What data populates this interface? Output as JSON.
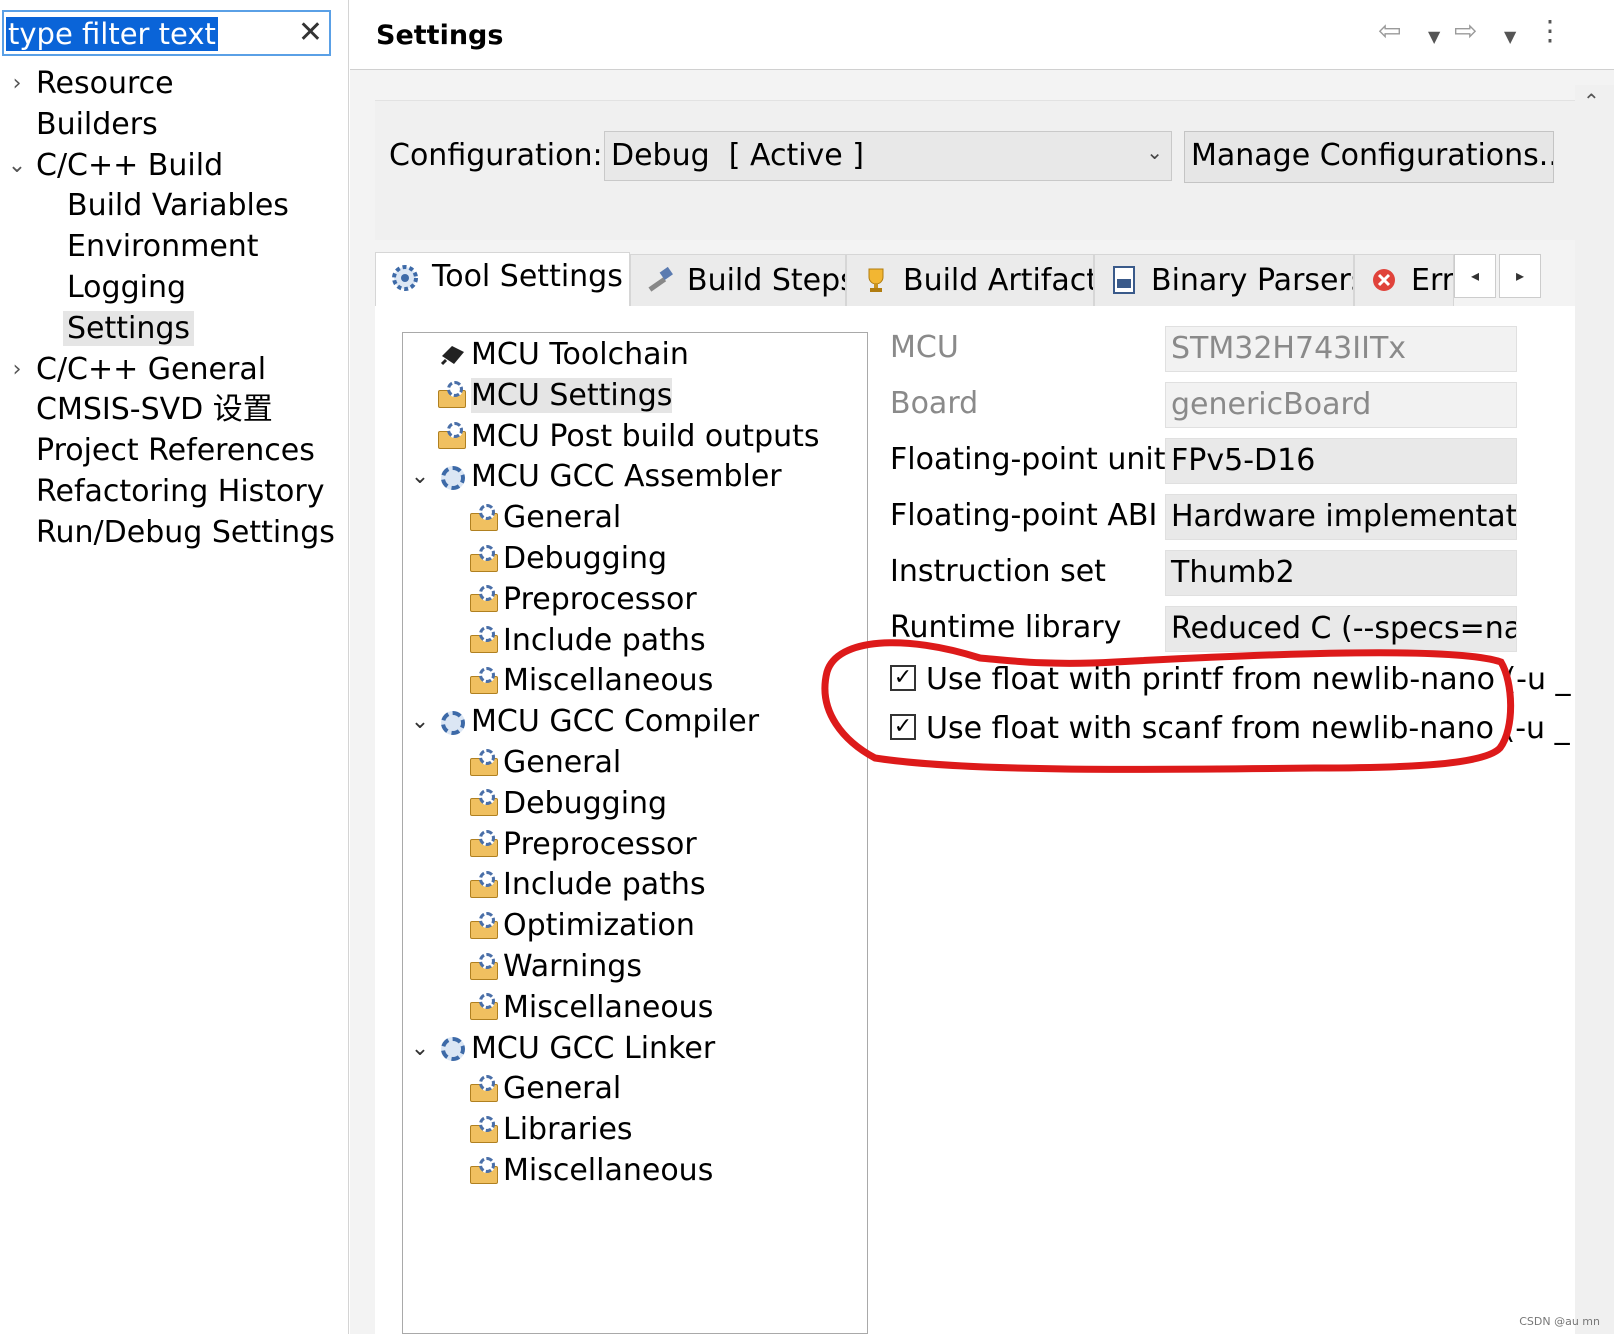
{
  "filter": {
    "value": "type filter text",
    "clear_glyph": "✕"
  },
  "nav": [
    {
      "label": "Resource",
      "twisty": "›"
    },
    {
      "label": "Builders",
      "twisty": ""
    },
    {
      "label": "C/C++ Build",
      "twisty": "⌄"
    },
    {
      "label": "Build Variables",
      "twisty": ""
    },
    {
      "label": "Environment",
      "twisty": ""
    },
    {
      "label": "Logging",
      "twisty": ""
    },
    {
      "label": "Settings",
      "twisty": "",
      "selected": true
    },
    {
      "label": "C/C++ General",
      "twisty": "›"
    },
    {
      "label": "CMSIS-SVD 设置",
      "twisty": ""
    },
    {
      "label": "Project References",
      "twisty": ""
    },
    {
      "label": "Refactoring History",
      "twisty": ""
    },
    {
      "label": "Run/Debug Settings",
      "twisty": ""
    }
  ],
  "header": {
    "title": "Settings",
    "back_icon": "⇦",
    "back_menu_icon": "▼",
    "forward_icon": "⇨",
    "forward_menu_icon": "▼",
    "more_icon": "⋮"
  },
  "scroll_up_icon": "⌃",
  "configuration": {
    "label": "Configuration:",
    "value": "Debug  [ Active ]",
    "dropdown_icon": "⌄",
    "manage_button": "Manage Configurations..."
  },
  "tabs": [
    {
      "label": "Tool Settings",
      "icon": "gear-icon",
      "active": true
    },
    {
      "label": "Build Steps",
      "icon": "hammer-icon"
    },
    {
      "label": "Build Artifact",
      "icon": "trophy-icon"
    },
    {
      "label": "Binary Parsers",
      "icon": "binary-file-icon"
    },
    {
      "label": "Erro",
      "icon": "error-icon"
    }
  ],
  "tab_nav": {
    "left": "◂",
    "right": "▸"
  },
  "tool_tree": [
    {
      "label": "MCU Toolchain",
      "level": 0,
      "icon": "chip-icon"
    },
    {
      "label": "MCU Settings",
      "level": 0,
      "icon": "folder-gear-icon",
      "selected": true
    },
    {
      "label": "MCU Post build outputs",
      "level": 0,
      "icon": "folder-gear-icon"
    },
    {
      "label": "MCU GCC Assembler",
      "level": 0,
      "icon": "gear-icon",
      "expander": "⌄"
    },
    {
      "label": "General",
      "level": 1,
      "icon": "folder-gear-icon"
    },
    {
      "label": "Debugging",
      "level": 1,
      "icon": "folder-gear-icon"
    },
    {
      "label": "Preprocessor",
      "level": 1,
      "icon": "folder-gear-icon"
    },
    {
      "label": "Include paths",
      "level": 1,
      "icon": "folder-gear-icon"
    },
    {
      "label": "Miscellaneous",
      "level": 1,
      "icon": "folder-gear-icon"
    },
    {
      "label": "MCU GCC Compiler",
      "level": 0,
      "icon": "gear-icon",
      "expander": "⌄"
    },
    {
      "label": "General",
      "level": 1,
      "icon": "folder-gear-icon"
    },
    {
      "label": "Debugging",
      "level": 1,
      "icon": "folder-gear-icon"
    },
    {
      "label": "Preprocessor",
      "level": 1,
      "icon": "folder-gear-icon"
    },
    {
      "label": "Include paths",
      "level": 1,
      "icon": "folder-gear-icon"
    },
    {
      "label": "Optimization",
      "level": 1,
      "icon": "folder-gear-icon"
    },
    {
      "label": "Warnings",
      "level": 1,
      "icon": "folder-gear-icon"
    },
    {
      "label": "Miscellaneous",
      "level": 1,
      "icon": "folder-gear-icon"
    },
    {
      "label": "MCU GCC Linker",
      "level": 0,
      "icon": "gear-icon",
      "expander": "⌄"
    },
    {
      "label": "General",
      "level": 1,
      "icon": "folder-gear-icon"
    },
    {
      "label": "Libraries",
      "level": 1,
      "icon": "folder-gear-icon"
    },
    {
      "label": "Miscellaneous",
      "level": 1,
      "icon": "folder-gear-icon"
    }
  ],
  "properties": [
    {
      "label": "MCU",
      "value": "STM32H743IITx",
      "disabled": true
    },
    {
      "label": "Board",
      "value": "genericBoard",
      "disabled": true
    },
    {
      "label": "Floating-point unit",
      "value": "FPv5-D16"
    },
    {
      "label": "Floating-point ABI",
      "value": "Hardware implementatio"
    },
    {
      "label": "Instruction set",
      "value": "Thumb2"
    },
    {
      "label": "Runtime library",
      "value": "Reduced C (--specs=nano"
    }
  ],
  "checkboxes": [
    {
      "label": "Use float with printf from newlib-nano (-u _",
      "checked": true
    },
    {
      "label": "Use float with scanf from newlib-nano (-u _",
      "checked": true
    }
  ],
  "check_glyph": "✓",
  "annotation": {
    "color": "#dd1a1a"
  },
  "watermark": "CSDN @au mn"
}
